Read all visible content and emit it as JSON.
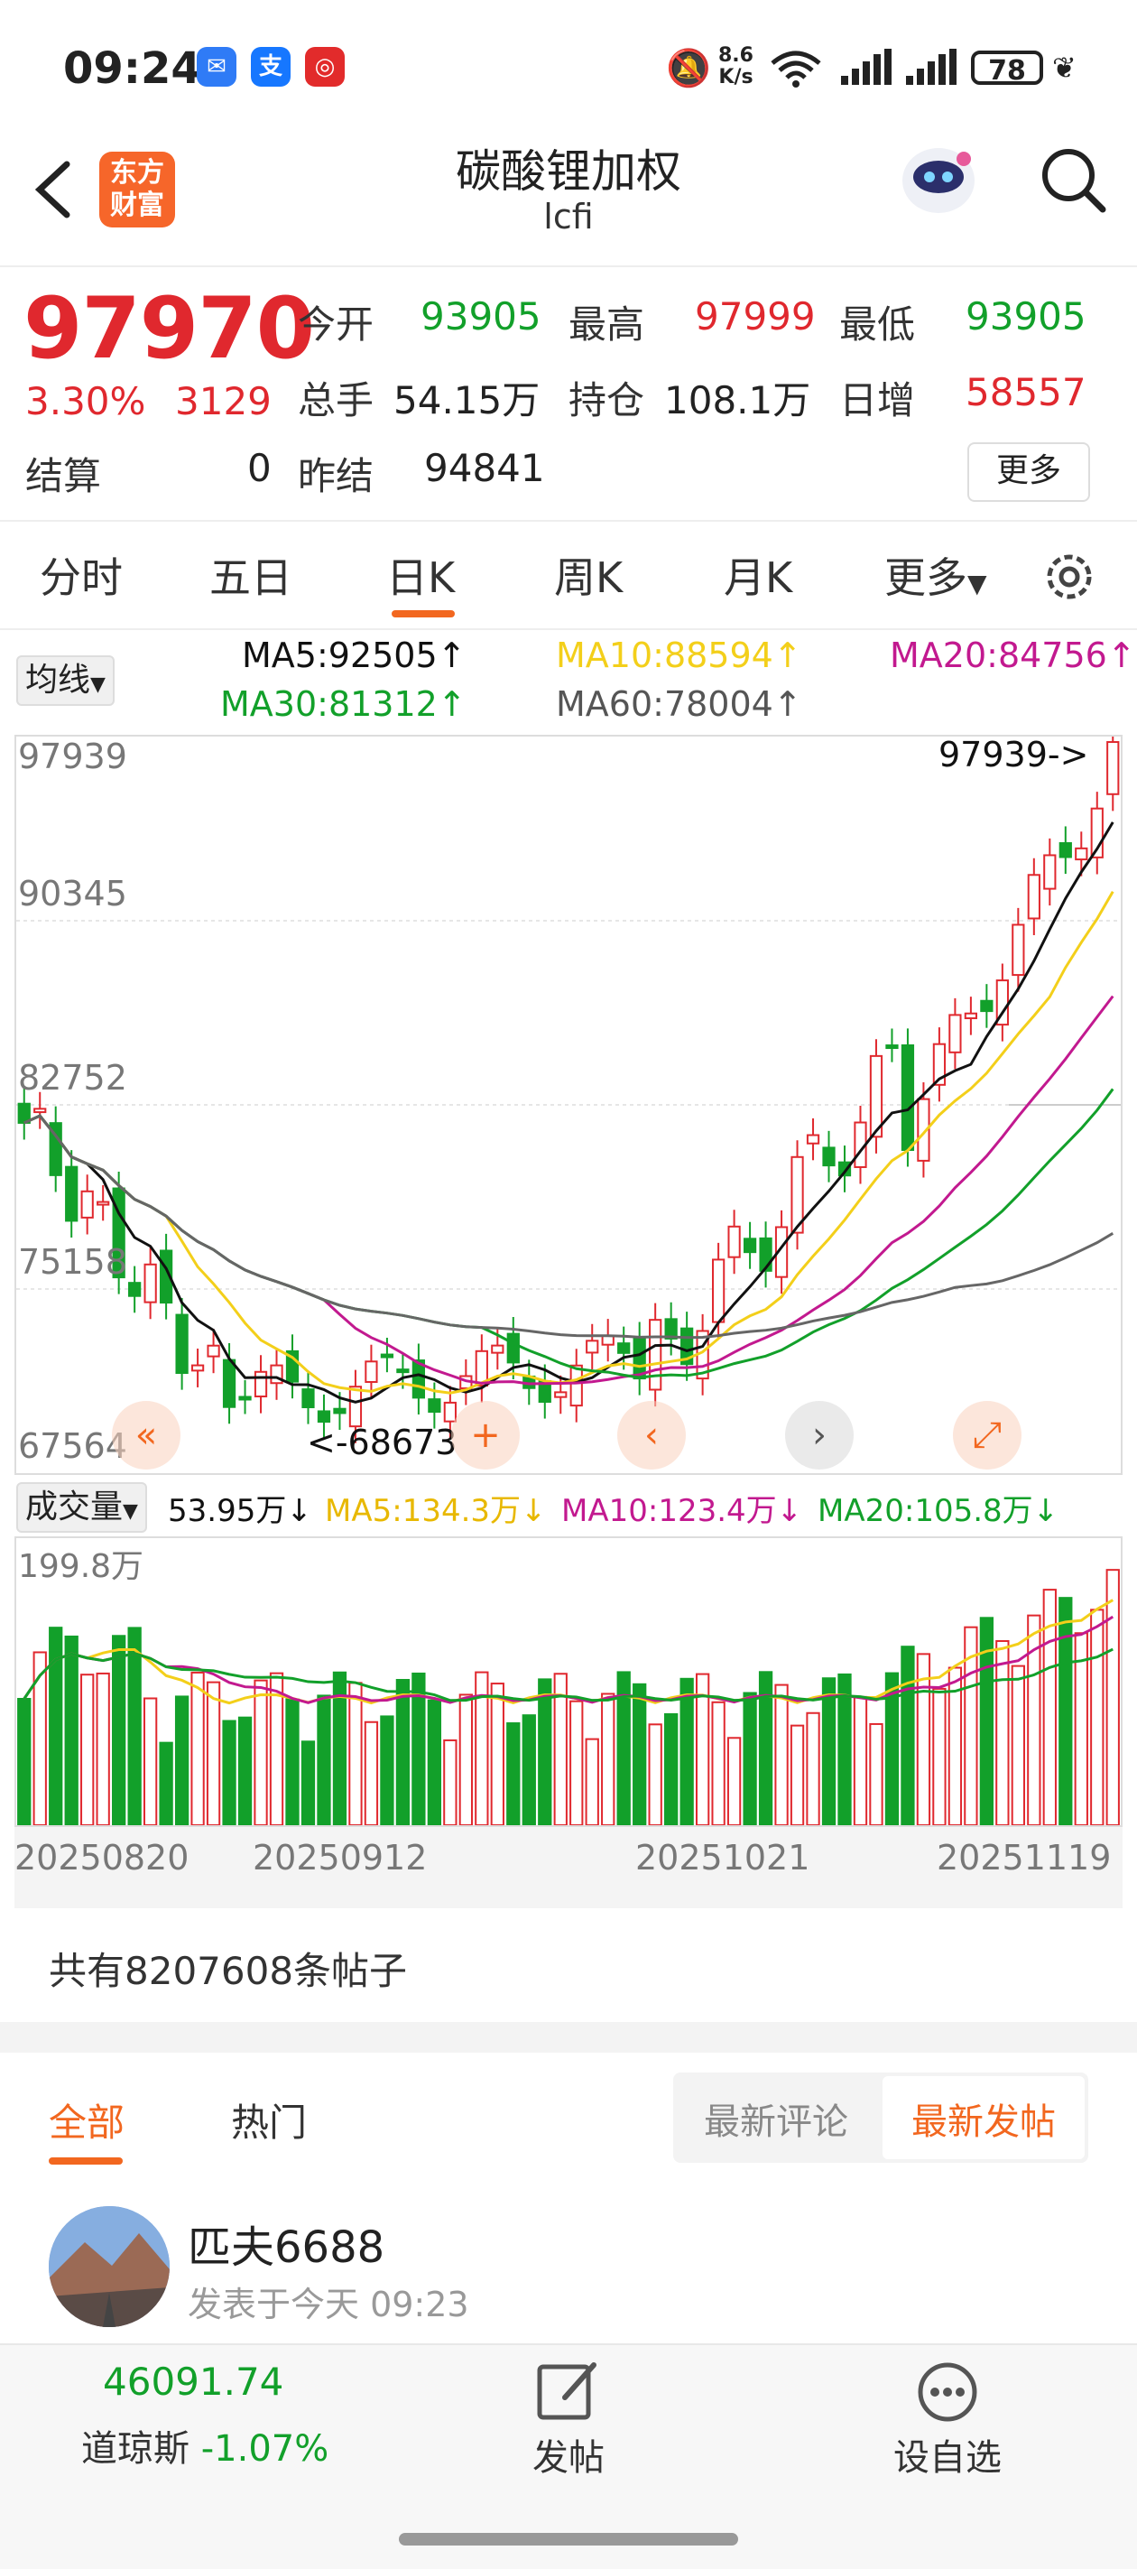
{
  "status_bar": {
    "time": "09:24",
    "net_speed_top": "8.6",
    "net_speed_bottom": "K/s",
    "battery": "78",
    "app_icons": [
      "message-app-icon",
      "alipay-icon",
      "netease-music-icon"
    ]
  },
  "header": {
    "logo_line1": "东方",
    "logo_line2": "财富",
    "title": "碳酸锂加权",
    "subtitle": "lcfi"
  },
  "quote": {
    "price": "97970",
    "change_pct": "3.30%",
    "change_abs": "3129",
    "settle_label": "结算",
    "settle_value": "0",
    "open_label": "今开",
    "open_value": "93905",
    "high_label": "最高",
    "high_value": "97999",
    "low_label": "最低",
    "low_value": "93905",
    "volume_label": "总手",
    "volume_value": "54.15万",
    "oi_label": "持仓",
    "oi_value": "108.1万",
    "oi_change_label": "日增",
    "oi_change_value": "58557",
    "prev_settle_label": "昨结",
    "prev_settle_value": "94841",
    "more_button": "更多"
  },
  "tabs": {
    "items": [
      "分时",
      "五日",
      "日K",
      "周K",
      "月K",
      "更多"
    ],
    "active_index": 2
  },
  "ma_legend": {
    "select": "均线",
    "ma5": "MA5:92505↑",
    "ma10": "MA10:88594↑",
    "ma20": "MA20:84756↑",
    "ma30": "MA30:81312↑",
    "ma60": "MA60:78004↑",
    "colors": {
      "ma5": "#111111",
      "ma10": "#f3cf1a",
      "ma20": "#c2198f",
      "ma30": "#12a02a",
      "ma60": "#666666"
    }
  },
  "kline": {
    "y_labels": [
      "97939",
      "90345",
      "82752",
      "75158",
      "67564"
    ],
    "max_marker": "97939->",
    "min_marker": "<-68673"
  },
  "volume_legend": {
    "select": "成交量",
    "vol": "53.95万↓",
    "ma5": "MA5:134.3万↓",
    "ma10": "MA10:123.4万↓",
    "ma20": "MA20:105.8万↓",
    "top_label": "199.8万"
  },
  "dates": [
    "20250820",
    "20250912",
    "20251021",
    "20251119"
  ],
  "posts": {
    "count_text": "共有8207608条帖子",
    "tab_all": "全部",
    "tab_hot": "热门",
    "sort_latest_comment": "最新评论",
    "sort_latest_post": "最新发帖",
    "first_post_user": "匹夫6688",
    "first_post_time": "发表于今天 09:23"
  },
  "bottom_bar": {
    "index_value": "46091.74",
    "index_name": "道琼斯",
    "index_change": "-1.07%",
    "post_label": "发帖",
    "watchlist_label": "设自选"
  }
}
